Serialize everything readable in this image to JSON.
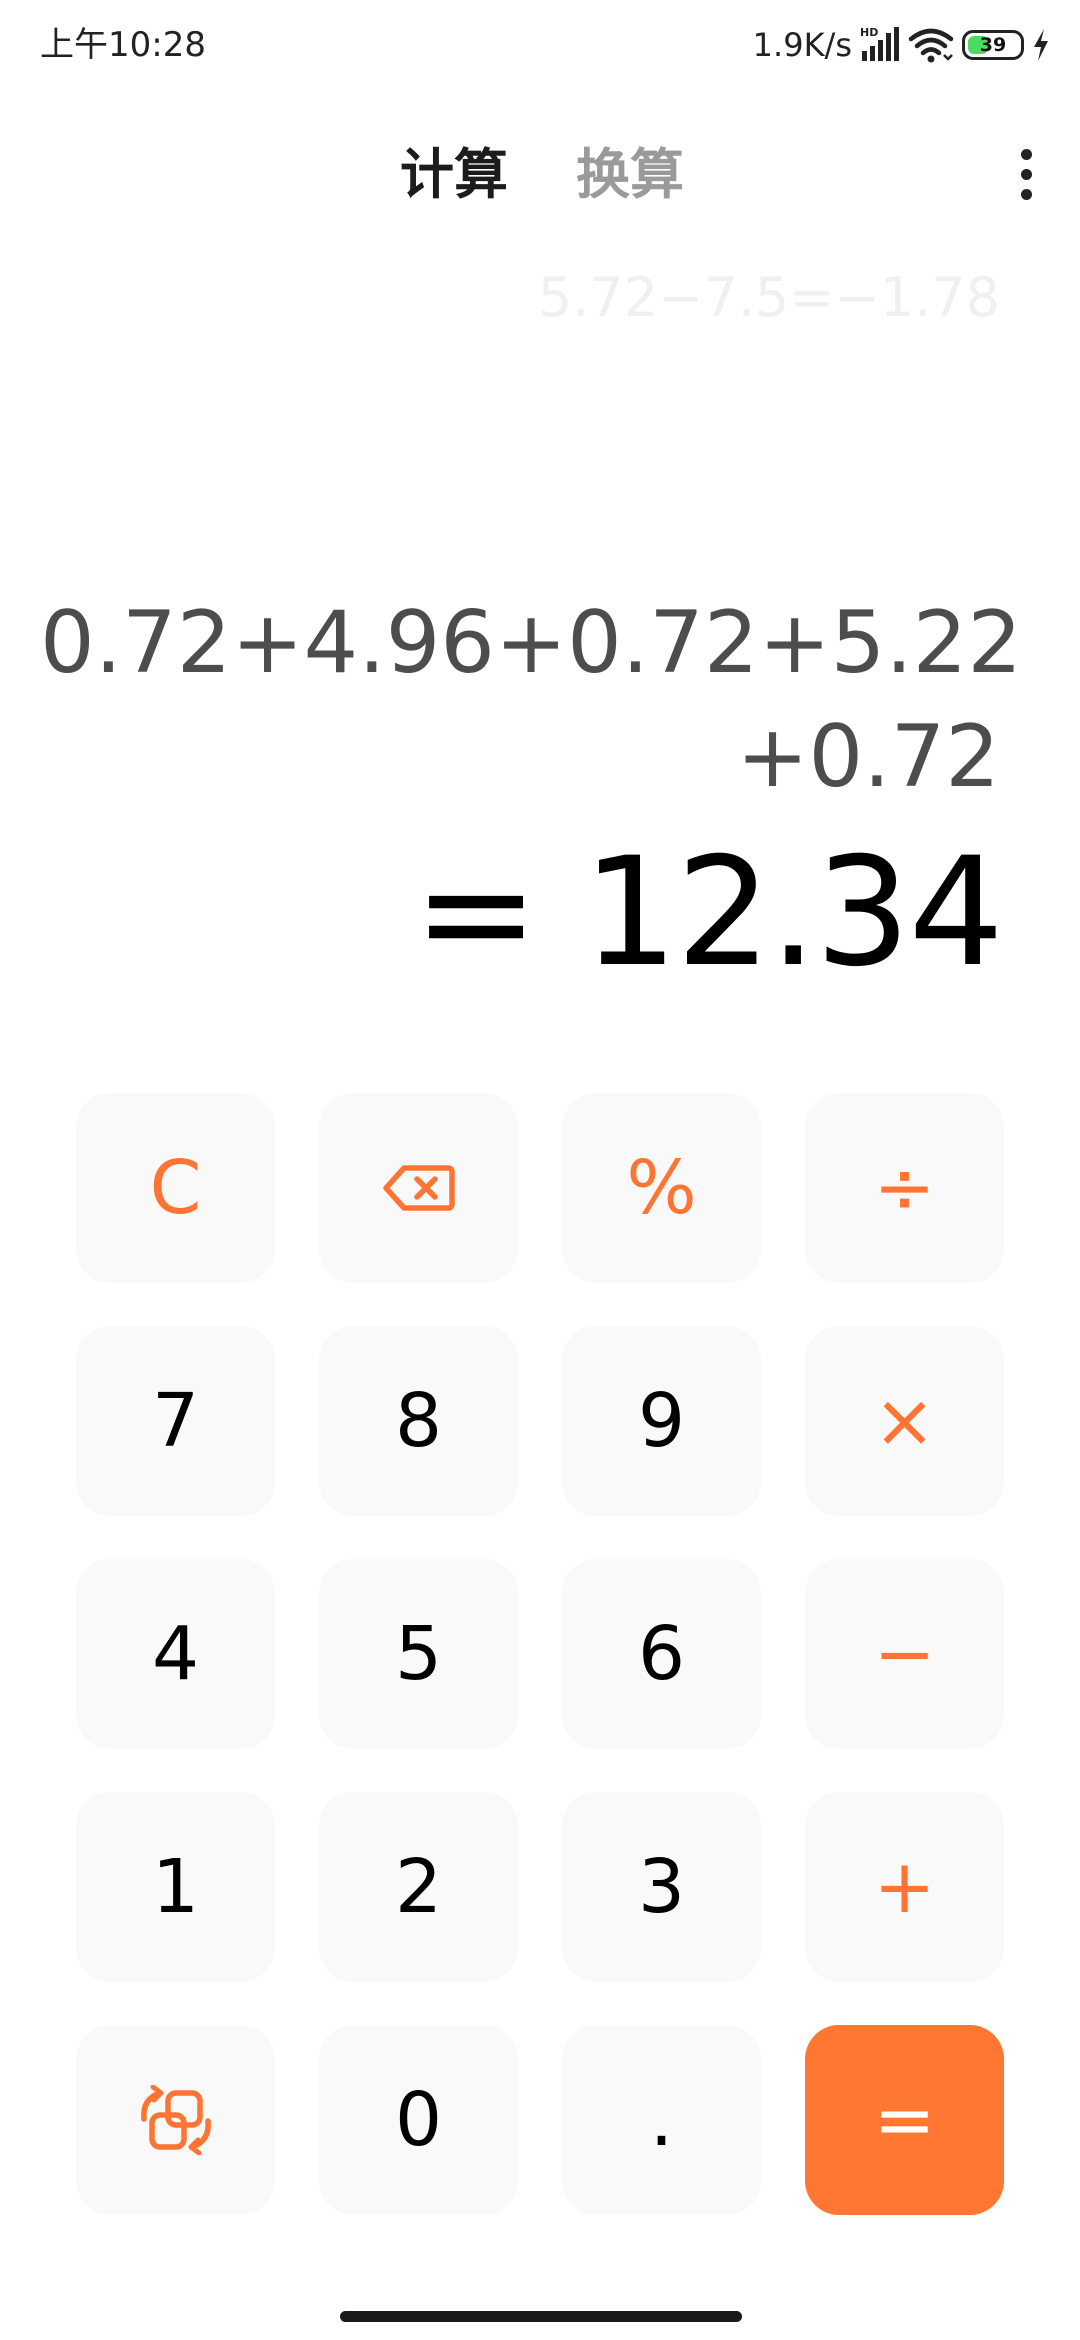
{
  "status_bar": {
    "time": "上午10:28",
    "net_speed": "1.9K/s",
    "network_badge": "HD",
    "battery_level": "39",
    "battery_fraction": 0.39,
    "battery_color": "#4cd964",
    "icons": [
      "signal-icon",
      "wifi-icon",
      "battery-icon",
      "charging-icon"
    ]
  },
  "header": {
    "tabs": [
      {
        "label": "计算",
        "active": true
      },
      {
        "label": "换算",
        "active": false
      }
    ],
    "more_icon": "more-vertical-icon"
  },
  "display": {
    "history": "5.72−7.5=−1.78",
    "expression_line1": "0.72+4.96+0.72+5.22",
    "expression_line2": "+0.72",
    "result": "= 12.34"
  },
  "keypad": {
    "clear": "C",
    "backspace_icon": "backspace-icon",
    "percent": "%",
    "divide": "÷",
    "seven": "7",
    "eight": "8",
    "nine": "9",
    "multiply": "×",
    "four": "4",
    "five": "5",
    "six": "6",
    "minus": "−",
    "one": "1",
    "two": "2",
    "three": "3",
    "plus": "+",
    "switch_icon": "switch-mode-icon",
    "zero": "0",
    "decimal": ".",
    "equals": "="
  },
  "colors": {
    "accent": "#ff7433",
    "equals_bg": "#ff7733",
    "key_bg": "#f9f9f9",
    "expression": "#4d4d4d",
    "history": "#f0f0f0"
  }
}
